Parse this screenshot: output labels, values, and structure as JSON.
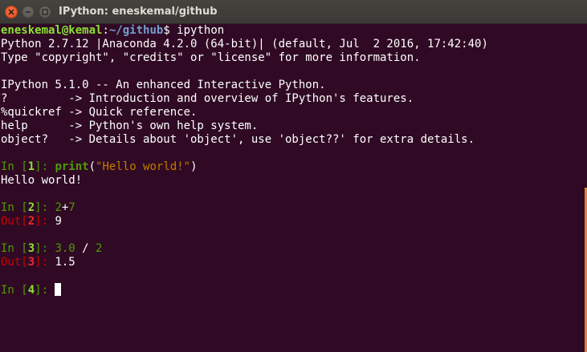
{
  "window": {
    "title": "IPython: eneskemal/github",
    "buttons": {
      "close_icon": "close-icon",
      "minimize_icon": "minimize-icon",
      "maximize_icon": "maximize-icon"
    }
  },
  "colors": {
    "background": "#300a24",
    "prompt_user": "#8ae234",
    "prompt_path": "#729fcf",
    "in_prompt": "#4e9a06",
    "out_prompt": "#cc0000",
    "string": "#c47a00"
  },
  "terminal": {
    "shell_prompt": {
      "user_host": "eneskemal@kemal",
      "sep": ":",
      "path": "~/github",
      "dollar": "$ ",
      "command": "ipython"
    },
    "banner": [
      "Python 2.7.12 |Anaconda 4.2.0 (64-bit)| (default, Jul  2 2016, 17:42:40)",
      "Type \"copyright\", \"credits\" or \"license\" for more information.",
      "",
      "IPython 5.1.0 -- An enhanced Interactive Python.",
      "?         -> Introduction and overview of IPython's features.",
      "%quickref -> Quick reference.",
      "help      -> Python's own help system.",
      "object?   -> Details about 'object', use 'object??' for extra details."
    ],
    "cells": [
      {
        "in_prefix": "In [",
        "in_num": "1",
        "in_suffix": "]: ",
        "code_func": "print",
        "code_open": "(",
        "code_string": "\"Hello world!\"",
        "code_close": ")",
        "stdout": "Hello world!"
      },
      {
        "in_prefix": "In [",
        "in_num": "2",
        "in_suffix": "]: ",
        "code_a": "2",
        "code_op": "+",
        "code_b": "7",
        "out_prefix": "Out[",
        "out_num": "2",
        "out_suffix": "]: ",
        "out_value": "9"
      },
      {
        "in_prefix": "In [",
        "in_num": "3",
        "in_suffix": "]: ",
        "code_a": "3.0",
        "code_op": " / ",
        "code_b": "2",
        "out_prefix": "Out[",
        "out_num": "3",
        "out_suffix": "]: ",
        "out_value": "1.5"
      },
      {
        "in_prefix": "In [",
        "in_num": "4",
        "in_suffix": "]: "
      }
    ]
  }
}
